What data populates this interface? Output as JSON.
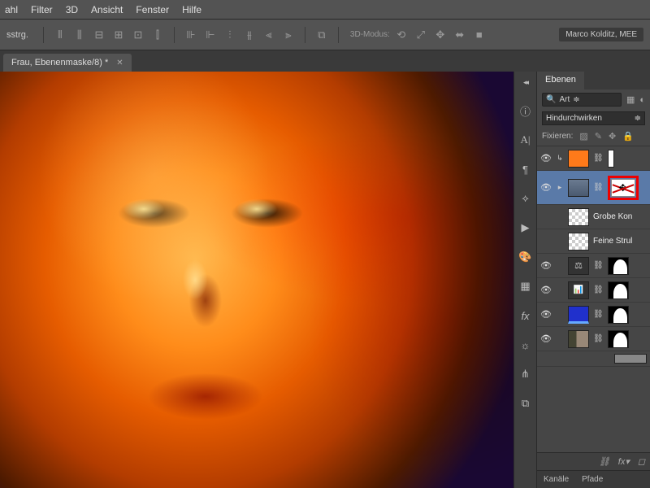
{
  "menu": {
    "items": [
      "ahl",
      "Filter",
      "3D",
      "Ansicht",
      "Fenster",
      "Hilfe"
    ]
  },
  "toolbar": {
    "left_label": "sstrg.",
    "mode_label": "3D-Modus:",
    "user": "Marco Kolditz, MEE"
  },
  "doc_tab": {
    "title": "Frau, Ebenenmaske/8) *"
  },
  "layers_panel": {
    "tab": "Ebenen",
    "filter_label": "Art",
    "blend_mode": "Hindurchwirken",
    "lock_label": "Fixieren:",
    "layers": [
      {
        "name": ""
      },
      {
        "name": ""
      },
      {
        "name": "Grobe Kon"
      },
      {
        "name": "Feine Strul"
      },
      {
        "name": ""
      },
      {
        "name": ""
      },
      {
        "name": ""
      },
      {
        "name": ""
      }
    ],
    "bottom_tabs": [
      "Kanäle",
      "Pfade"
    ]
  }
}
